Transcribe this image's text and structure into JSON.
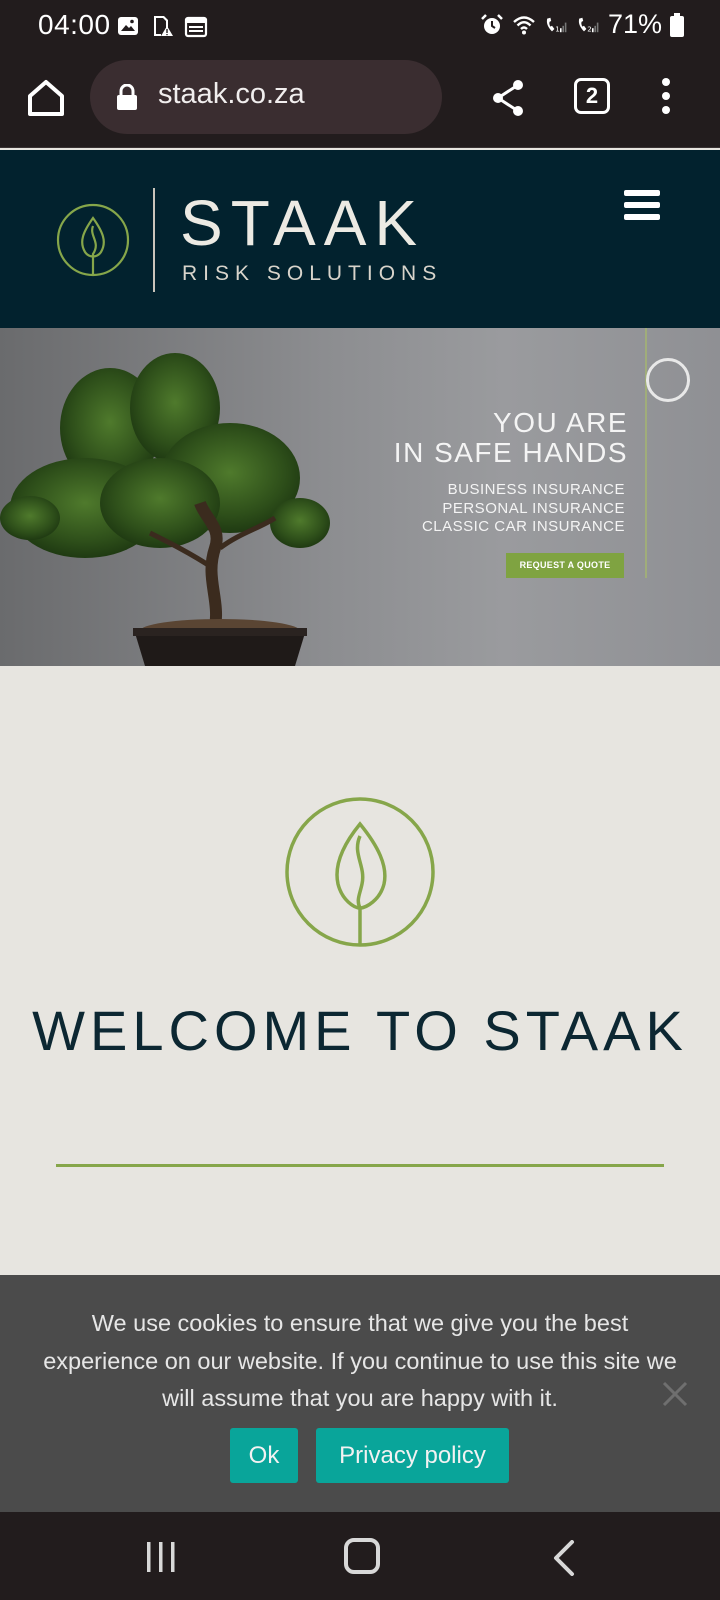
{
  "status_bar": {
    "time": "04:00",
    "battery": "71%",
    "left_icons": [
      "image-icon",
      "sim-alert-icon",
      "calendar-icon"
    ],
    "right_icons": [
      "alarm-icon",
      "wifi-icon",
      "wifi-call-1-icon",
      "wifi-call-2-icon",
      "battery-icon"
    ]
  },
  "browser": {
    "url": "staak.co.za",
    "tab_count": "2"
  },
  "site_header": {
    "brand": "STAAK",
    "tagline": "RISK SOLUTIONS"
  },
  "hero": {
    "headline_line1": "YOU ARE",
    "headline_line2": "IN SAFE HANDS",
    "services": [
      "BUSINESS INSURANCE",
      "PERSONAL INSURANCE",
      "CLASSIC CAR INSURANCE"
    ],
    "cta_label": "REQUEST A QUOTE"
  },
  "welcome": {
    "title": "WELCOME TO STAAK"
  },
  "cookie_banner": {
    "message": "We use cookies to ensure that we give you the best experience on our website. If you continue to use this site we will assume that you are happy with it.",
    "ok_label": "Ok",
    "privacy_label": "Privacy policy"
  },
  "colors": {
    "header_bg": "#02222e",
    "accent_green": "#86a64a",
    "cookie_button": "#09a59a",
    "page_bg": "#e7e5e0"
  }
}
